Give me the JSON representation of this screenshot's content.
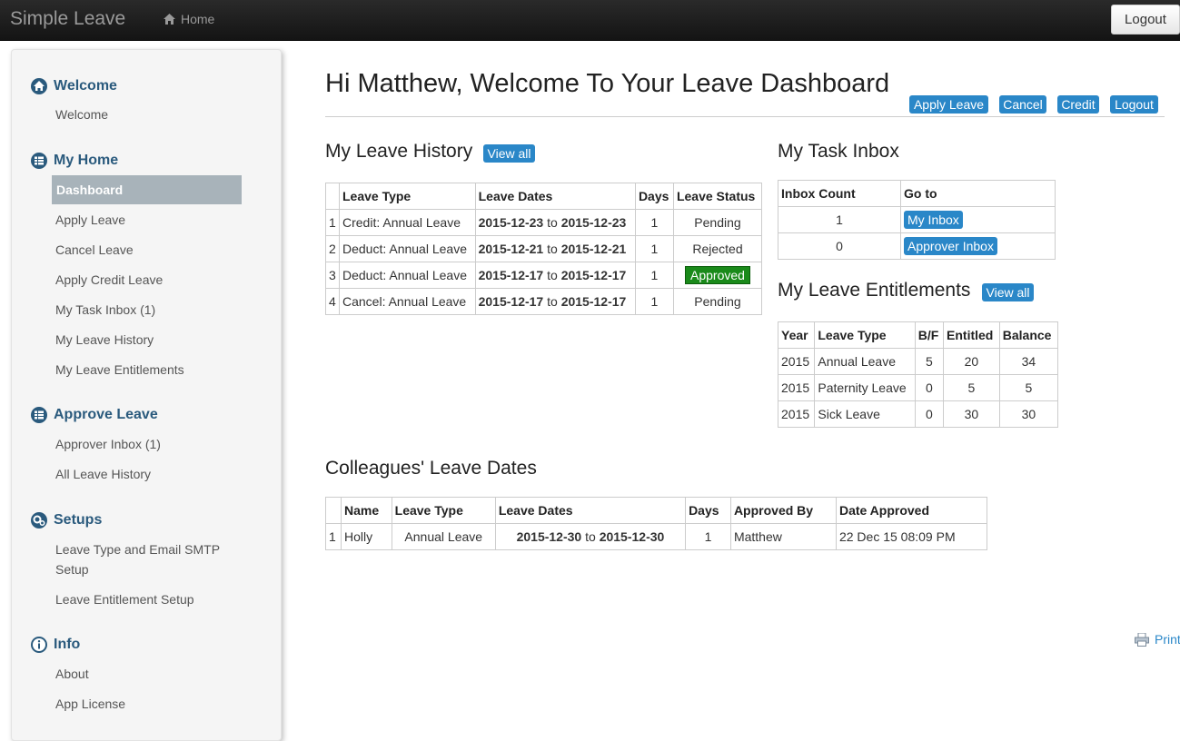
{
  "app": {
    "brand": "Simple Leave",
    "home": "Home",
    "logout": "Logout"
  },
  "sidebar": {
    "welcome": {
      "header": "Welcome",
      "items": [
        "Welcome"
      ]
    },
    "my_home": {
      "header": "My Home",
      "items": [
        "Dashboard",
        "Apply Leave",
        "Cancel Leave",
        "Apply Credit Leave",
        "My Task Inbox (1)",
        "My Leave History",
        "My Leave Entitlements"
      ]
    },
    "approve": {
      "header": "Approve Leave",
      "items": [
        "Approver Inbox (1)",
        "All Leave History"
      ]
    },
    "setups": {
      "header": "Setups",
      "items": [
        "Leave Type and Email SMTP",
        "Setup",
        "Leave Entitlement Setup"
      ]
    },
    "info": {
      "header": "Info",
      "items": [
        "About",
        "App License"
      ]
    }
  },
  "main": {
    "title": "Hi Matthew, Welcome To Your Leave Dashboard",
    "actions": [
      "Apply Leave",
      "Cancel",
      "Credit",
      "Logout"
    ]
  },
  "leave_history": {
    "title": "My Leave History",
    "view_all": "View all",
    "headers": [
      "Leave Type",
      "Leave Dates",
      "Days",
      "Leave Status"
    ],
    "rows": [
      {
        "n": "1",
        "type": "Credit: Annual Leave",
        "from": "2015-12-23",
        "to_word": "to",
        "to": "2015-12-23",
        "days": "1",
        "status": "Pending"
      },
      {
        "n": "2",
        "type": "Deduct: Annual Leave",
        "from": "2015-12-21",
        "to_word": "to",
        "to": "2015-12-21",
        "days": "1",
        "status": "Rejected"
      },
      {
        "n": "3",
        "type": "Deduct: Annual Leave",
        "from": "2015-12-17",
        "to_word": "to",
        "to": "2015-12-17",
        "days": "1",
        "status": "Approved"
      },
      {
        "n": "4",
        "type": "Cancel: Annual Leave",
        "from": "2015-12-17",
        "to_word": "to",
        "to": "2015-12-17",
        "days": "1",
        "status": "Pending"
      }
    ]
  },
  "task_inbox": {
    "title": "My Task Inbox",
    "headers": [
      "Inbox Count",
      "Go to"
    ],
    "rows": [
      {
        "count": "1",
        "link": "My Inbox"
      },
      {
        "count": "0",
        "link": "Approver Inbox"
      }
    ]
  },
  "entitlements": {
    "title": "My Leave Entitlements",
    "view_all": "View all",
    "headers": [
      "Year",
      "Leave Type",
      "B/F",
      "Entitled",
      "Balance"
    ],
    "rows": [
      {
        "year": "2015",
        "type": "Annual Leave",
        "bf": "5",
        "entitled": "20",
        "balance": "34"
      },
      {
        "year": "2015",
        "type": "Paternity Leave",
        "bf": "0",
        "entitled": "5",
        "balance": "5"
      },
      {
        "year": "2015",
        "type": "Sick Leave",
        "bf": "0",
        "entitled": "30",
        "balance": "30"
      }
    ]
  },
  "colleagues": {
    "title": "Colleagues' Leave Dates",
    "headers": [
      "Name",
      "Leave Type",
      "Leave Dates",
      "Days",
      "Approved By",
      "Date Approved"
    ],
    "rows": [
      {
        "n": "1",
        "name": "Holly",
        "type": "Annual Leave",
        "from": "2015-12-30",
        "to_word": "to",
        "to": "2015-12-30",
        "days": "1",
        "by": "Matthew",
        "date": "22 Dec 15 08:09 PM"
      }
    ]
  },
  "print": "Print",
  "colors": {
    "accent": "#2a87c8",
    "nav_header": "#2a5a7d",
    "approved": "#1a8a1a",
    "active_nav": "#a8b3ba"
  }
}
